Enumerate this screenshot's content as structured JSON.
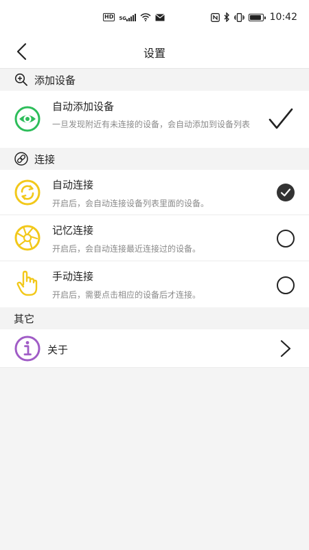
{
  "status_bar": {
    "hd": "HD",
    "network": "5G",
    "time": "10:42"
  },
  "header": {
    "title": "设置"
  },
  "sections": {
    "add_device": {
      "label": "添加设备"
    },
    "connect": {
      "label": "连接"
    },
    "other": {
      "label": "其它"
    }
  },
  "rows": {
    "auto_add": {
      "title": "自动添加设备",
      "desc": "一旦发现附近有未连接的设备，会自动添加到设备列表",
      "checked": true
    },
    "auto_connect": {
      "title": "自动连接",
      "desc": "开启后，会自动连接设备列表里面的设备。",
      "selected": true
    },
    "memory_connect": {
      "title": "记忆连接",
      "desc": "开启后，会自动连接最近连接过的设备。",
      "selected": false
    },
    "manual_connect": {
      "title": "手动连接",
      "desc": "开启后，需要点击相应的设备后才连接。",
      "selected": false
    },
    "about": {
      "title": "关于"
    }
  },
  "colors": {
    "green_icon": "#2dbd5a",
    "yellow_icon": "#f2c81a",
    "purple_icon": "#a05cc6",
    "selected_dark": "#333333",
    "section_bg": "#f3f3f3"
  }
}
